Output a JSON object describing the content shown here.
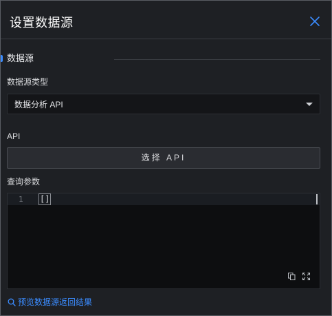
{
  "header": {
    "title": "设置数据源",
    "close_icon": "close-icon"
  },
  "section": {
    "title": "数据源"
  },
  "datasource_type": {
    "label": "数据源类型",
    "selected": "数据分析 API",
    "icon": "caret-down-icon"
  },
  "api": {
    "label": "API",
    "button_label": "选择 API"
  },
  "query_params": {
    "label": "查询参数",
    "editor": {
      "line_number": "1",
      "code": "[]"
    },
    "tools": {
      "copy_icon": "copy-icon",
      "fullscreen_icon": "fullscreen-icon"
    }
  },
  "footer": {
    "preview_label": "预览数据源返回结果",
    "preview_icon": "search-icon"
  },
  "colors": {
    "accent": "#3b8cff",
    "background": "#1e2024",
    "input_background": "#141518"
  }
}
